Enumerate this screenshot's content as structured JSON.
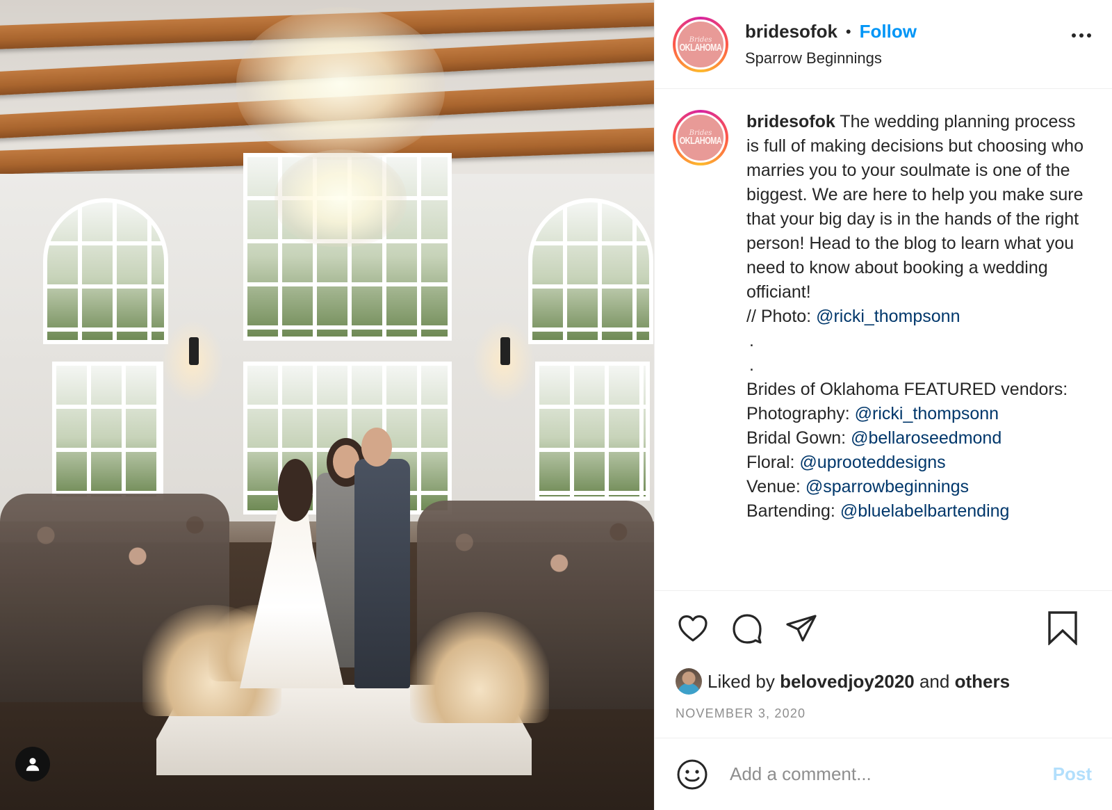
{
  "post": {
    "author": {
      "username": "bridesofok",
      "avatar_logo_top": "Brides",
      "avatar_logo_main": "OKLAHOMA",
      "location": "Sparrow Beginnings",
      "follow_label": "Follow",
      "separator": "•"
    },
    "caption": {
      "username": "bridesofok",
      "lines": [
        {
          "text": "The wedding planning process is full of making decisions but choosing who marries you to your soulmate is one of the biggest. We are here to help you make sure that your big day is in the hands of the right person! Head to the blog to learn what you need to know about booking a wedding officiant!"
        },
        {
          "prefix": "// Photo: ",
          "mention": "@ricki_thompsonn"
        },
        {
          "text": "."
        },
        {
          "text": "."
        },
        {
          "text": "Brides of Oklahoma FEATURED vendors:"
        },
        {
          "prefix": "Photography: ",
          "mention": "@ricki_thompsonn"
        },
        {
          "prefix": "Bridal Gown: ",
          "mention": "@bellaroseedmond"
        },
        {
          "prefix": "Floral: ",
          "mention": "@uprooteddesigns"
        },
        {
          "prefix": "Venue: ",
          "mention": "@sparrowbeginnings"
        },
        {
          "prefix": "Bartending: ",
          "mention": "@bluelabelbartending"
        }
      ]
    },
    "actions": {
      "like_icon": "heart-icon",
      "comment_icon": "comment-bubble-icon",
      "share_icon": "paper-plane-icon",
      "save_icon": "bookmark-icon"
    },
    "likes": {
      "prefix": "Liked by",
      "user": "belovedjoy2020",
      "middle": "and",
      "others": "others"
    },
    "date": "NOVEMBER 3, 2020",
    "comment": {
      "placeholder": "Add a comment...",
      "post_label": "Post",
      "emoji_icon": "smiley-icon"
    },
    "photo": {
      "tag_icon": "user-tag-icon"
    },
    "colors": {
      "accent": "#0095f6",
      "mention": "#00376b",
      "muted": "#8e8e8e",
      "post_disabled": "#b2dffc",
      "avatar_bg": "#e89a97"
    }
  }
}
